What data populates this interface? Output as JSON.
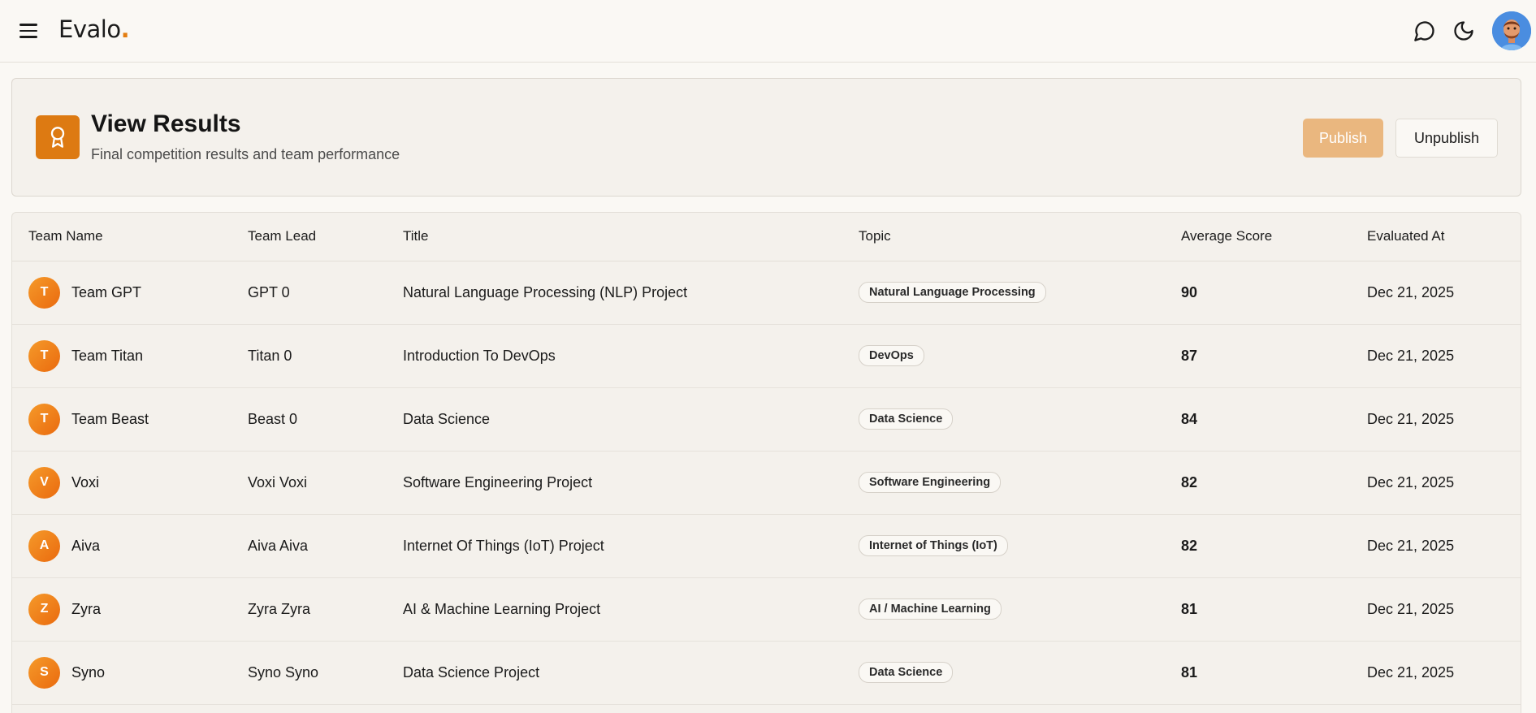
{
  "app": {
    "brand": "Evalo",
    "brand_dot": "."
  },
  "navbar": {
    "icons": [
      "menu-icon",
      "chat-icon",
      "moon-icon",
      "user-avatar"
    ]
  },
  "header": {
    "title": "View Results",
    "subtitle": "Final competition results and team performance",
    "publish_label": "Publish",
    "unpublish_label": "Unpublish",
    "badge_icon": "award-icon"
  },
  "table": {
    "columns": [
      "Team Name",
      "Team Lead",
      "Title",
      "Topic",
      "Average Score",
      "Evaluated At"
    ],
    "rows": [
      {
        "initial": "T",
        "team": "Team GPT",
        "lead": "GPT 0",
        "title": "Natural Language Processing (NLP) Project",
        "topic": "Natural Language Processing",
        "score": "90",
        "date": "Dec 21, 2025"
      },
      {
        "initial": "T",
        "team": "Team Titan",
        "lead": "Titan 0",
        "title": "Introduction To DevOps",
        "topic": "DevOps",
        "score": "87",
        "date": "Dec 21, 2025"
      },
      {
        "initial": "T",
        "team": "Team Beast",
        "lead": "Beast 0",
        "title": "Data Science",
        "topic": "Data Science",
        "score": "84",
        "date": "Dec 21, 2025"
      },
      {
        "initial": "V",
        "team": "Voxi",
        "lead": "Voxi Voxi",
        "title": "Software Engineering Project",
        "topic": "Software Engineering",
        "score": "82",
        "date": "Dec 21, 2025"
      },
      {
        "initial": "A",
        "team": "Aiva",
        "lead": "Aiva Aiva",
        "title": "Internet Of Things (IoT) Project",
        "topic": "Internet of Things (IoT)",
        "score": "82",
        "date": "Dec 21, 2025"
      },
      {
        "initial": "Z",
        "team": "Zyra",
        "lead": "Zyra Zyra",
        "title": "AI & Machine Learning Project",
        "topic": "AI / Machine Learning",
        "score": "81",
        "date": "Dec 21, 2025"
      },
      {
        "initial": "S",
        "team": "Syno",
        "lead": "Syno Syno",
        "title": "Data Science Project",
        "topic": "Data Science",
        "score": "81",
        "date": "Dec 21, 2025"
      }
    ]
  },
  "colors": {
    "accent": "#dd7a12",
    "publish_bg": "#eab77f",
    "page_bg": "#faf8f4",
    "card_bg": "#f4f1ec"
  }
}
